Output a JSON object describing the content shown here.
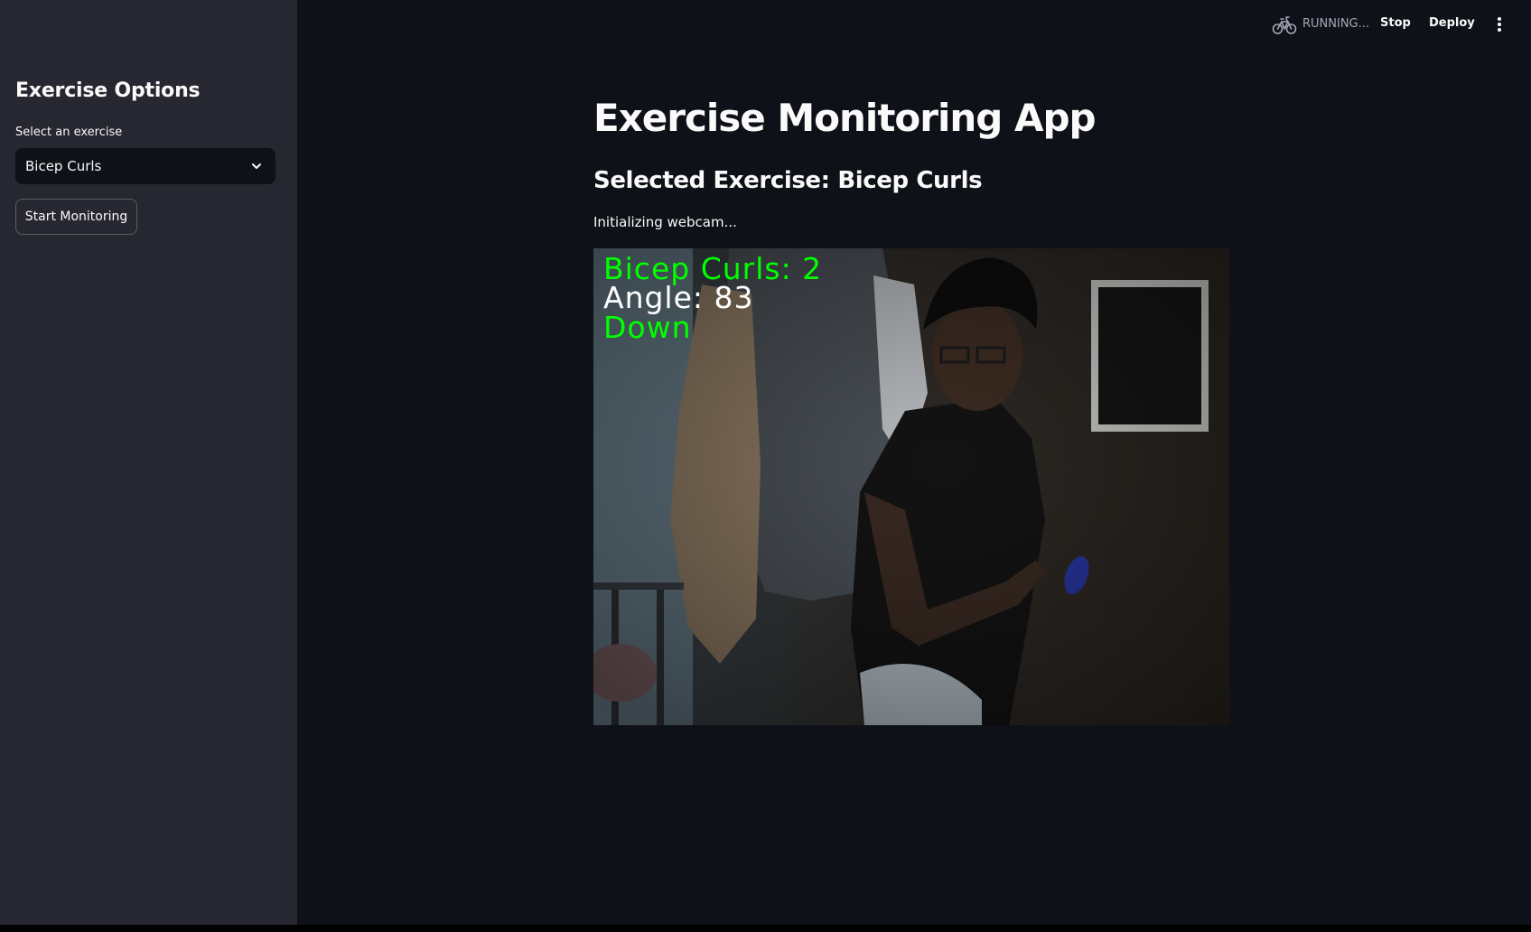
{
  "sidebar": {
    "title": "Exercise Options",
    "select": {
      "label": "Select an exercise",
      "value": "Bicep Curls"
    },
    "start_button_label": "Start Monitoring"
  },
  "toolbar": {
    "running_icon": "bicycle-icon",
    "running_text": "RUNNING...",
    "stop_label": "Stop",
    "deploy_label": "Deploy",
    "menu_icon": "vertical-ellipsis-icon"
  },
  "main": {
    "title": "Exercise Monitoring App",
    "subheader": "Selected Exercise: Bicep Curls",
    "status": "Initializing webcam...",
    "webcam": {
      "counter_text": "Bicep Curls: 2",
      "angle_text": "Angle: 83",
      "stage_text": "Down"
    }
  },
  "colors": {
    "background": "#0e1117",
    "sidebar": "#262730",
    "text": "#fafafa",
    "overlay_green": "#00ff00",
    "overlay_white": "#ffffff"
  }
}
